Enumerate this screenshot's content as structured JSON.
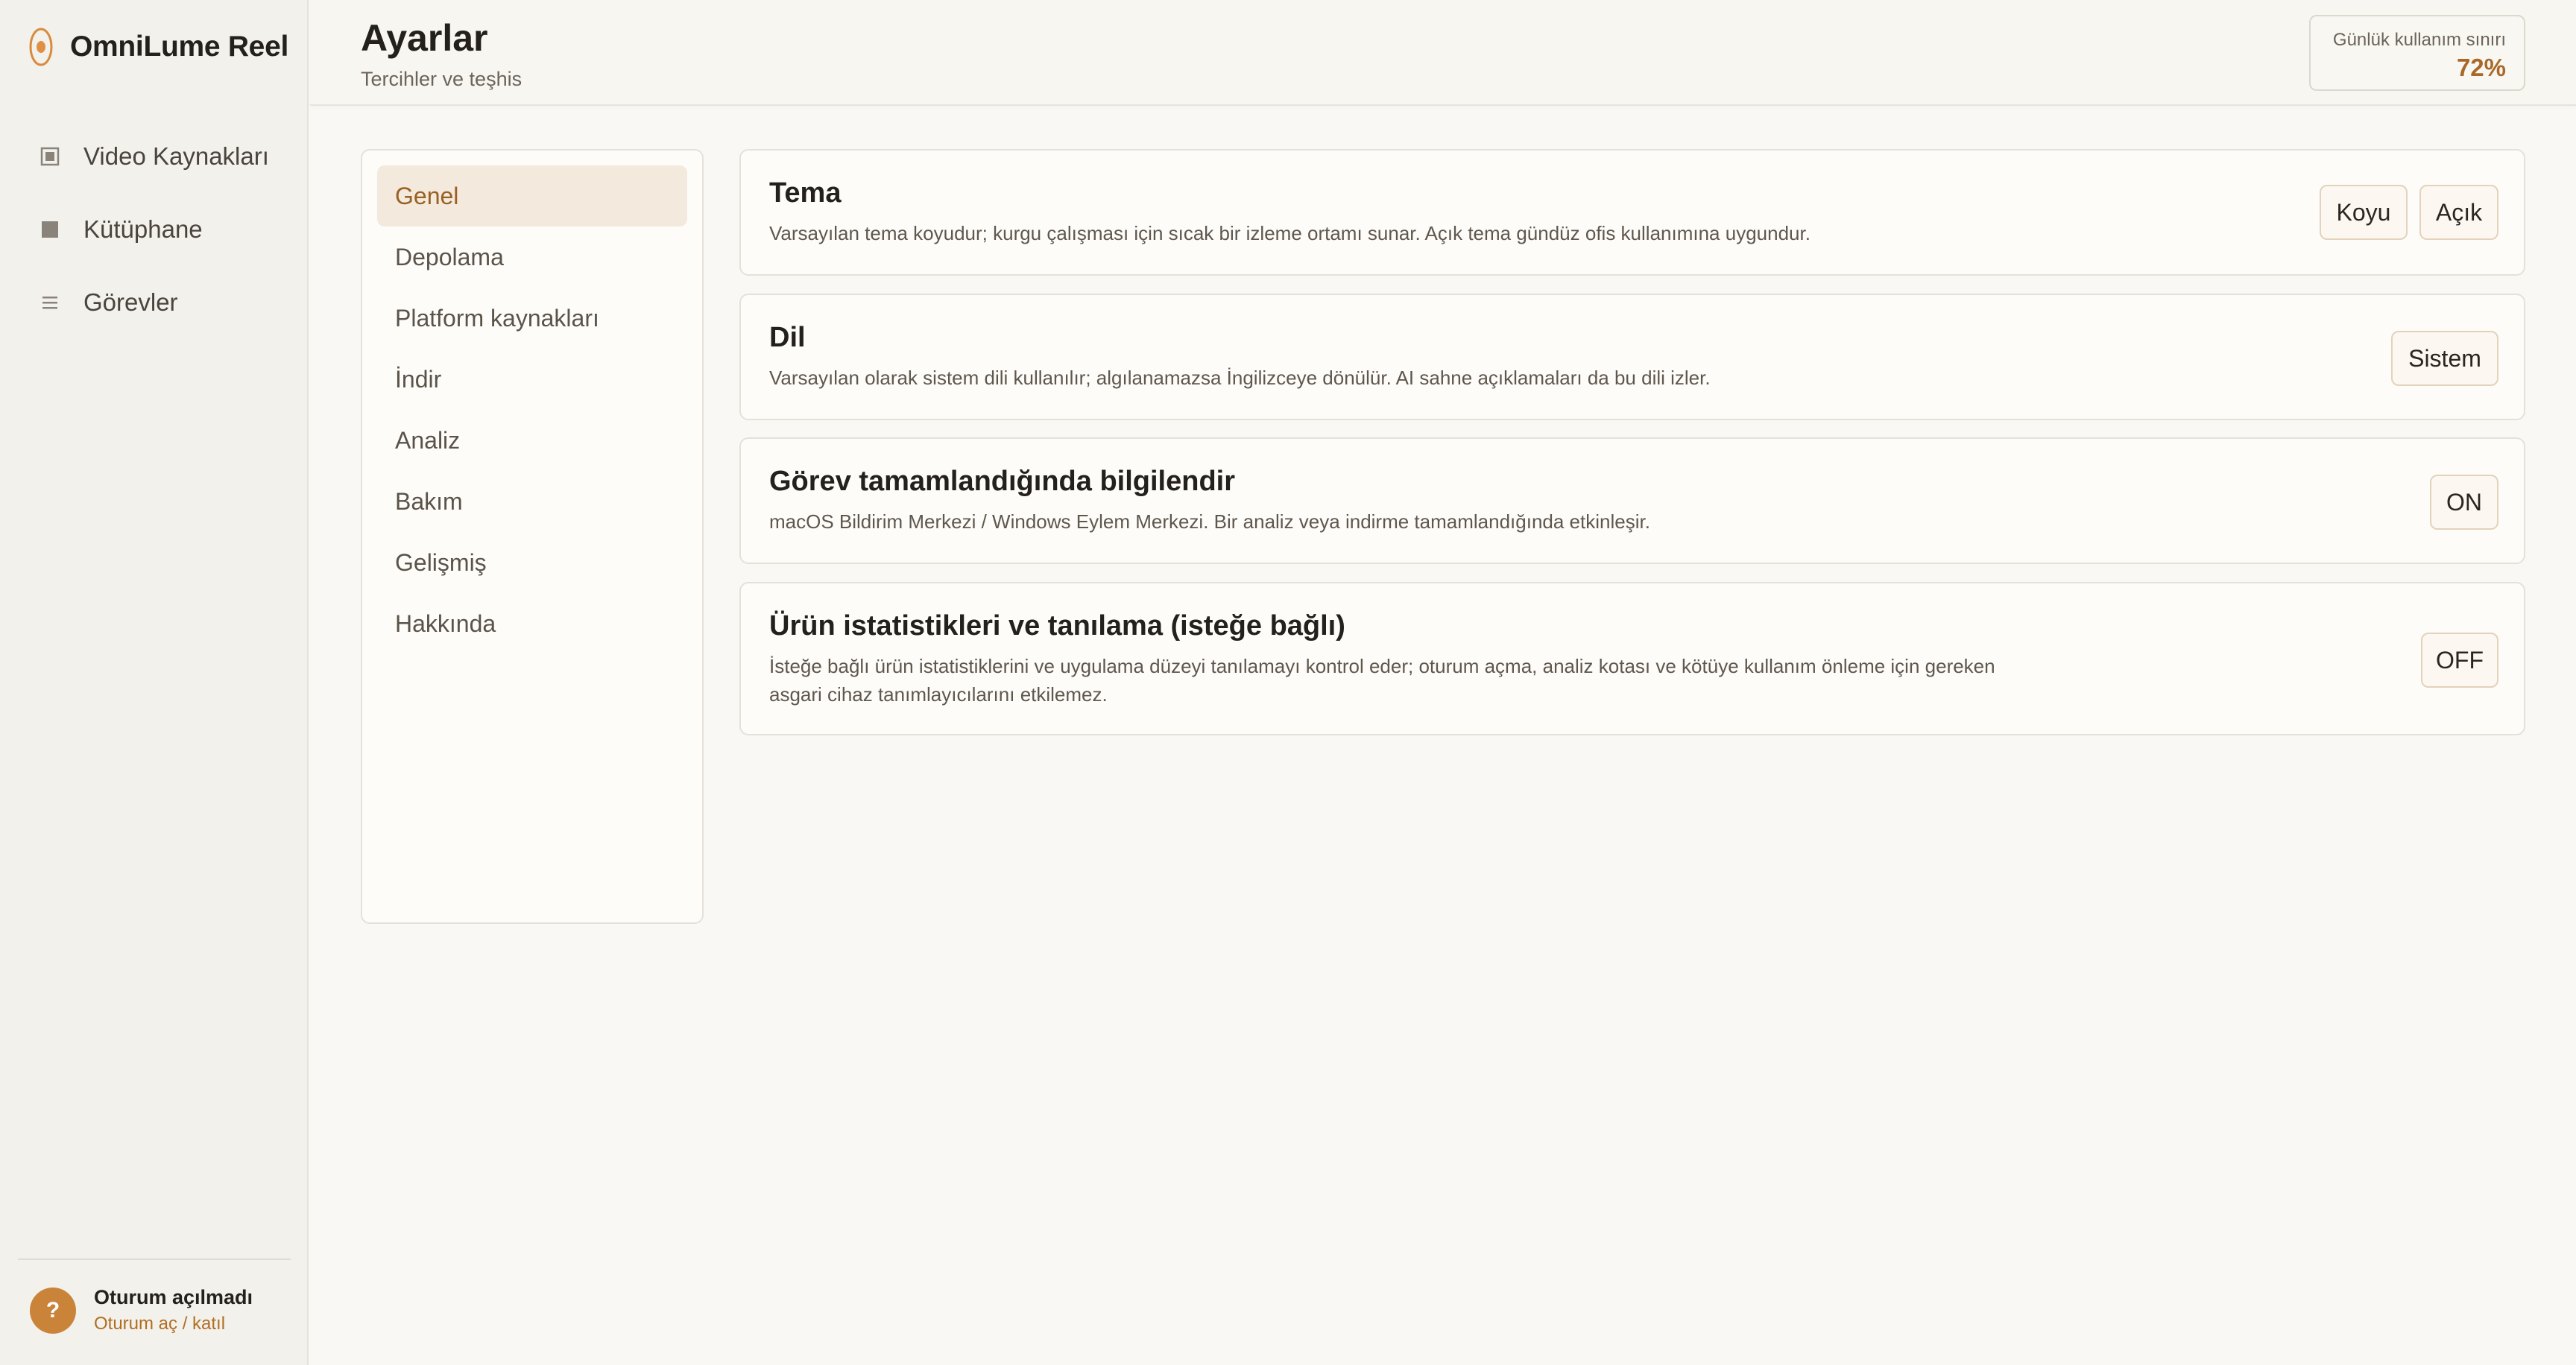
{
  "app": {
    "name": "OmniLume Reel",
    "accent": "#c9843a"
  },
  "sidebar": {
    "items": [
      {
        "label": "Video Kaynakları",
        "icon": "video-icon"
      },
      {
        "label": "Kütüphane",
        "icon": "library-icon"
      },
      {
        "label": "Görevler",
        "icon": "list-icon"
      }
    ]
  },
  "user": {
    "avatar": "?",
    "name": "Oturum açılmadı",
    "action": "Oturum aç / katıl"
  },
  "header": {
    "title": "Ayarlar",
    "subtitle": "Tercihler ve teşhis",
    "usage_label": "Günlük kullanım sınırı",
    "usage_value": "72%"
  },
  "settings_menu": {
    "active": "Genel",
    "items": [
      "Genel",
      "Depolama",
      "Platform kaynakları",
      "İndir",
      "Analiz",
      "Bakım",
      "Gelişmiş",
      "Hakkında"
    ]
  },
  "cards": {
    "theme": {
      "title": "Tema",
      "desc": "Varsayılan tema koyudur; kurgu çalışması için sıcak bir izleme ortamı sunar. Açık tema gündüz ofis kullanımına uygundur.",
      "dark_label": "Koyu",
      "light_label": "Açık"
    },
    "language": {
      "title": "Dil",
      "desc": "Varsayılan olarak sistem dili kullanılır; algılanamazsa İngilizceye dönülür. AI sahne açıklamaları da bu dili izler.",
      "value": "Sistem"
    },
    "notify": {
      "title": "Görev tamamlandığında bilgilendir",
      "desc": "macOS Bildirim Merkezi / Windows Eylem Merkezi. Bir analiz veya indirme tamamlandığında etkinleşir.",
      "value": "ON"
    },
    "telemetry": {
      "title": "Ürün istatistikleri ve tanılama (isteğe bağlı)",
      "desc_line1": "İsteğe bağlı ürün istatistiklerini ve uygulama düzeyi tanılamayı kontrol eder; oturum açma, analiz kotası ve kötüye kullanım önleme için gereken",
      "desc_line2": "asgari cihaz tanımlayıcılarını etkilemez.",
      "value": "OFF"
    }
  }
}
